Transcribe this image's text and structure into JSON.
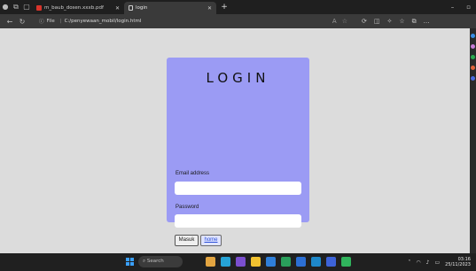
{
  "browser": {
    "tabs": [
      {
        "label": "m_baub_dosen.xxxb.pdf",
        "active": false,
        "favicon": "pdf-icon"
      },
      {
        "label": "login",
        "active": true,
        "favicon": "document-icon"
      }
    ],
    "new_tab_glyph": "+",
    "address": {
      "scheme_label": "File",
      "path": "C:/penyewaan_mobil/login.html"
    }
  },
  "login": {
    "title": "LOGIN",
    "email_label": "Email address",
    "email_value": "",
    "password_label": "Password",
    "password_value": "",
    "submit_label": "Masuk",
    "secondary_label": "home"
  },
  "taskbar": {
    "search_placeholder": "Search",
    "time": "03:16",
    "date": "25/11/2023"
  },
  "colors": {
    "card": "#9b9bf4",
    "page_bg": "#dcdcdc",
    "browser_chrome": "#1f1f1f"
  }
}
